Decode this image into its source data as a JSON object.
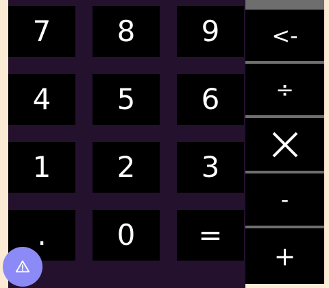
{
  "keypad": {
    "k7": "7",
    "k8": "8",
    "k9": "9",
    "k4": "4",
    "k5": "5",
    "k6": "6",
    "k1": "1",
    "k2": "2",
    "k3": "3",
    "dot": ".",
    "k0": "0",
    "equals": "="
  },
  "operators": {
    "backspace": "<-",
    "divide": "÷",
    "minus": "-",
    "plus": "+"
  },
  "icons": {
    "multiply": "multiply-icon",
    "fab": "warning-icon"
  },
  "colors": {
    "background": "#fcebd4",
    "keypad_bg": "#23112e",
    "key_bg": "#000000",
    "separator": "#6e6e6e",
    "fab": "#8c8af7"
  }
}
